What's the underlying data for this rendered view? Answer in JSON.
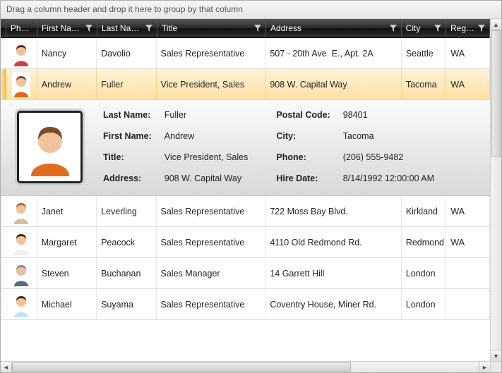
{
  "groupbar_text": "Drag a column header and drop it here to group by that column",
  "columns": {
    "photo": "Photo",
    "first": "First Name",
    "last": "Last Name",
    "title": "Title",
    "address": "Address",
    "city": "City",
    "region": "Region"
  },
  "rows": [
    {
      "first": "Nancy",
      "last": "Davolio",
      "title": "Sales Representative",
      "address": "507 - 20th Ave. E., Apt. 2A",
      "city": "Seattle",
      "region": "WA",
      "avatar": {
        "skin": "#f2c29b",
        "hair": "#5a2a16",
        "shirt": "#d63c4a"
      }
    },
    {
      "first": "Andrew",
      "last": "Fuller",
      "title": "Vice President, Sales",
      "address": "908 W. Capital Way",
      "city": "Tacoma",
      "region": "WA",
      "selected": true,
      "avatar": {
        "skin": "#f2c29b",
        "hair": "#7a4a2a",
        "shirt": "#e06a1e"
      }
    },
    {
      "first": "Janet",
      "last": "Leverling",
      "title": "Sales Representative",
      "address": "722 Moss Bay Blvd.",
      "city": "Kirkland",
      "region": "WA",
      "avatar": {
        "skin": "#f2c29b",
        "hair": "#a86b2e",
        "shirt": "#d9b8a0"
      }
    },
    {
      "first": "Margaret",
      "last": "Peacock",
      "title": "Sales Representative",
      "address": "4110 Old Redmond Rd.",
      "city": "Redmond",
      "region": "WA",
      "avatar": {
        "skin": "#f2c29b",
        "hair": "#2a2a2a",
        "shirt": "#f5f0e6"
      }
    },
    {
      "first": "Steven",
      "last": "Buchanan",
      "title": "Sales Manager",
      "address": "14 Garrett Hill",
      "city": "London",
      "region": "",
      "avatar": {
        "skin": "#e8bfa0",
        "hair": "#888888",
        "shirt": "#5a6b7a"
      }
    },
    {
      "first": "Michael",
      "last": "Suyama",
      "title": "Sales Representative",
      "address": "Coventry House, Miner Rd.",
      "city": "London",
      "region": "",
      "avatar": {
        "skin": "#f2c29b",
        "hair": "#3a2a16",
        "shirt": "#bfe4ff"
      }
    }
  ],
  "detail": {
    "labels": {
      "last": "Last Name:",
      "first": "First Name:",
      "title": "Title:",
      "address": "Address:",
      "postal": "Postal Code:",
      "city": "City:",
      "phone": "Phone:",
      "hire": "Hire Date:"
    },
    "values": {
      "last": "Fuller",
      "first": "Andrew",
      "title": "Vice President, Sales",
      "address": "908 W. Capital Way",
      "postal": "98401",
      "city": "Tacoma",
      "phone": "(206) 555-9482",
      "hire": "8/14/1992 12:00:00 AM"
    },
    "avatar": {
      "skin": "#f2c29b",
      "hair": "#7a4a2a",
      "shirt": "#e06a1e"
    }
  }
}
